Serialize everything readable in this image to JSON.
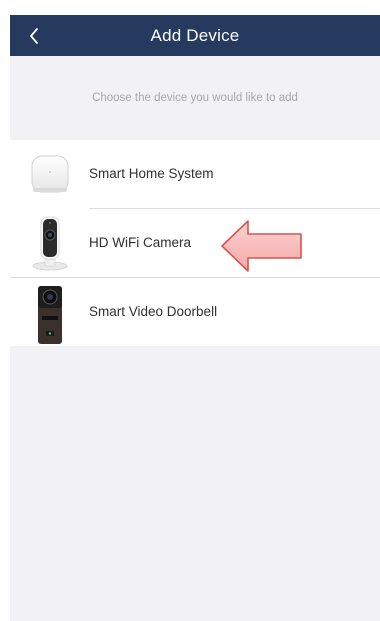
{
  "header": {
    "title": "Add Device",
    "back_icon": "chevron-left-icon",
    "background": "#253a5e"
  },
  "hint": {
    "text": "Choose the device you would like to add"
  },
  "devices": [
    {
      "label": "Smart Home System",
      "icon": "smart-home-hub-icon"
    },
    {
      "label": "HD WiFi Camera",
      "icon": "wifi-camera-icon"
    },
    {
      "label": "Smart Video Doorbell",
      "icon": "video-doorbell-icon"
    }
  ],
  "annotation": {
    "type": "arrow",
    "points_to": "HD WiFi Camera",
    "fill": "#f7b9b9",
    "stroke": "#d9534f"
  },
  "colors": {
    "page_background": "#f2f2f4",
    "list_background": "#ffffff",
    "hint_text": "#a8a8ac"
  }
}
